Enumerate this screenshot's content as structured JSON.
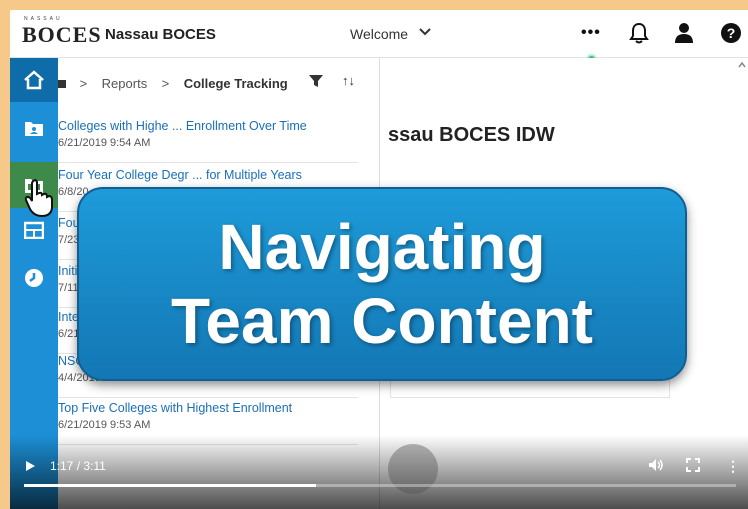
{
  "header": {
    "logo_small": "NASSAU",
    "logo": "BOCES",
    "app_name": "Nassau BOCES",
    "welcome_label": "Welcome",
    "chevron": "⌄",
    "more": "•••",
    "bell": "🔔",
    "user": "👤",
    "help": "?"
  },
  "sidebar": {
    "items": [
      {
        "icon": "home-icon",
        "glyph": "⌂"
      },
      {
        "icon": "my-content-icon",
        "glyph": "▣"
      },
      {
        "icon": "team-content-icon",
        "glyph": "▤"
      },
      {
        "icon": "dashboard-icon",
        "glyph": "▦"
      },
      {
        "icon": "recent-icon",
        "glyph": "◔"
      }
    ]
  },
  "breadcrumb": {
    "sep": ">",
    "reports": "Reports",
    "current": "College Tracking",
    "filter": "▼",
    "sort": "↑↓"
  },
  "items": [
    {
      "title": "Colleges with Highe ... Enrollment Over Time",
      "date": "6/21/2019 9:54 AM"
    },
    {
      "title": "Four Year College Degr ... for Multiple Years",
      "date": "6/8/20"
    },
    {
      "title": "Fou",
      "date": "7/23"
    },
    {
      "title": "Initia",
      "date": "7/11/"
    },
    {
      "title": "Inter",
      "date": "6/21"
    },
    {
      "title": "NSC",
      "date": "4/4/2019 3:3"
    },
    {
      "title": "Top Five Colleges with Highest Enrollment",
      "date": "6/21/2019 9:53 AM"
    }
  ],
  "right_pane": {
    "title": "ssau BOCES IDW"
  },
  "banner": {
    "line1": "Navigating",
    "line2": "Team Content"
  },
  "video": {
    "time": "1:17 / 3:11",
    "progress": 0.41,
    "volume": "🔊",
    "fullscreen": "⛶",
    "menu": "⋮"
  }
}
